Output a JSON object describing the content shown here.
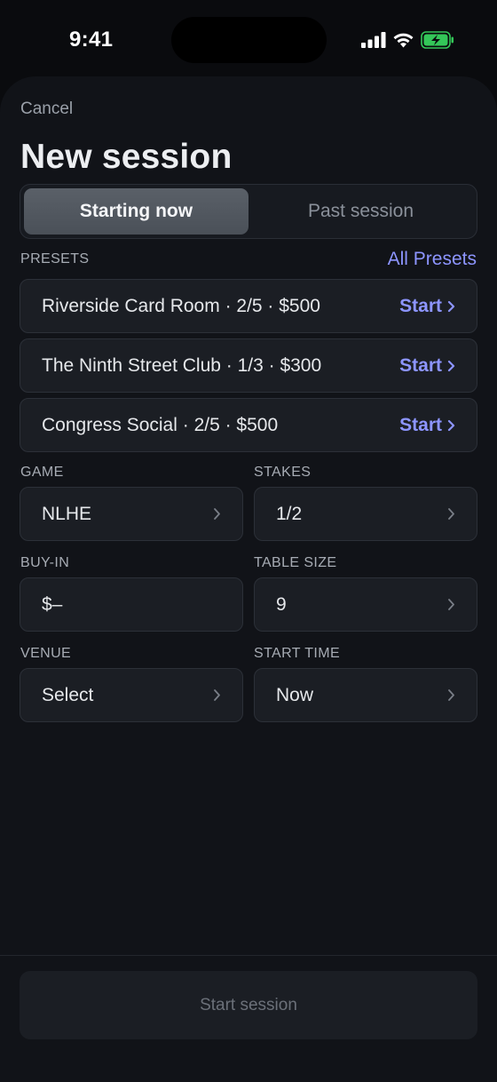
{
  "status_bar": {
    "time": "9:41"
  },
  "header": {
    "cancel_label": "Cancel",
    "title": "New session"
  },
  "mode_toggle": {
    "options": [
      "Starting now",
      "Past session"
    ],
    "selected": "Starting now"
  },
  "presets": {
    "label": "PRESETS",
    "all_link": "All Presets",
    "items": [
      {
        "text": "Riverside Card Room · 2/5 · $500",
        "action": "Start"
      },
      {
        "text": "The Ninth Street Club · 1/3 · $300",
        "action": "Start"
      },
      {
        "text": "Congress Social · 2/5 · $500",
        "action": "Start"
      }
    ]
  },
  "fields": {
    "game": {
      "label": "GAME",
      "value": "NLHE"
    },
    "stakes": {
      "label": "STAKES",
      "value": "1/2"
    },
    "buy_in": {
      "label": "BUY-IN",
      "value": "$–"
    },
    "table_size": {
      "label": "TABLE SIZE",
      "value": "9"
    },
    "venue": {
      "label": "VENUE",
      "value": "Select"
    },
    "start_time": {
      "label": "START TIME",
      "value": "Now"
    }
  },
  "footer": {
    "start_label": "Start session"
  },
  "colors": {
    "accent": "#8d95ff",
    "background": "#0a0b0e",
    "card": "#1b1e24",
    "battery": "#34c759"
  },
  "icons": [
    "signal-icon",
    "wifi-icon",
    "battery-charging-icon",
    "chevron-right-icon"
  ]
}
